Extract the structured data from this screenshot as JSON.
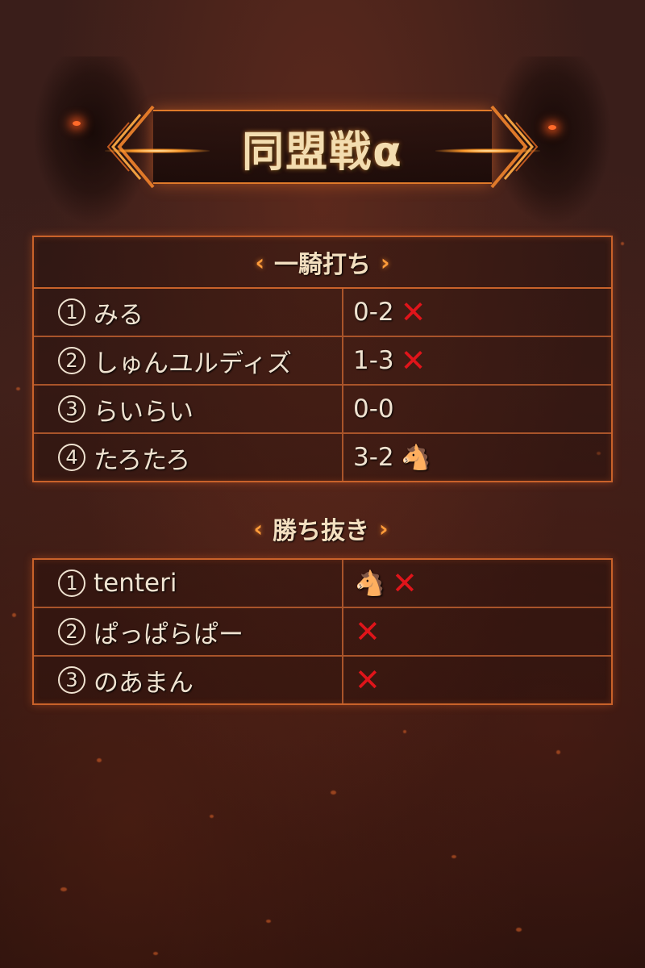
{
  "title": "同盟戦α",
  "sections": [
    {
      "title": "一騎打ち",
      "rows": [
        {
          "num": "1",
          "name": "みる",
          "score": "0-2",
          "marks": [
            "x"
          ]
        },
        {
          "num": "2",
          "name": "しゅんユルディズ",
          "score": "1-3",
          "marks": [
            "x"
          ]
        },
        {
          "num": "3",
          "name": "らいらい",
          "score": "0-0",
          "marks": []
        },
        {
          "num": "4",
          "name": "たろたろ",
          "score": "3-2",
          "marks": [
            "horse"
          ]
        }
      ]
    },
    {
      "title": "勝ち抜き",
      "rows": [
        {
          "num": "1",
          "name": "tenteri",
          "score": "",
          "marks": [
            "horse",
            "x"
          ]
        },
        {
          "num": "2",
          "name": "ぱっぱらぱー",
          "score": "",
          "marks": [
            "x"
          ]
        },
        {
          "num": "3",
          "name": "のあまん",
          "score": "",
          "marks": [
            "x"
          ]
        }
      ]
    }
  ],
  "icons": {
    "x": "cross-mark-icon",
    "horse": "horse-face-icon",
    "bracket_left": "‹",
    "bracket_right": "›",
    "x_glyph": "✕",
    "horse_glyph": "🐴"
  },
  "colors": {
    "accent": "#e07a2a",
    "cross": "#e0141a",
    "text": "#efe2d0",
    "title": "#f3ddb0"
  }
}
